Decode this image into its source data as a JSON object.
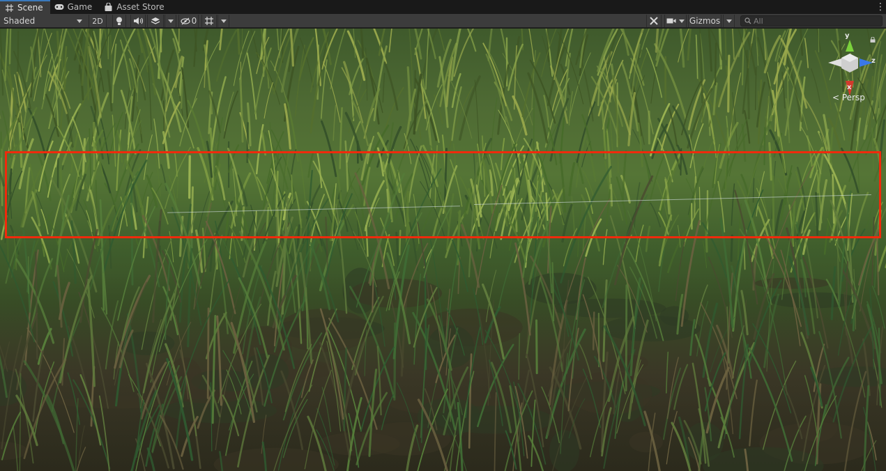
{
  "tabs": [
    {
      "label": "Scene",
      "icon": "grid-icon",
      "active": true
    },
    {
      "label": "Game",
      "icon": "gamepad-icon",
      "active": false
    },
    {
      "label": "Asset Store",
      "icon": "shopping-bag-icon",
      "active": false
    }
  ],
  "toolbar": {
    "draw_mode": "Shaded",
    "toggle_2d": "2D",
    "hidden_count": "0",
    "gizmos_label": "Gizmos",
    "search_placeholder": "All"
  },
  "gizmo": {
    "x_label": "x",
    "y_label": "y",
    "z_label": "z",
    "projection_label": "< Persp"
  },
  "colors": {
    "selection_outline": "#f02a0c",
    "tab_highlight": "#3a79bb",
    "x_axis": "#d23a2c",
    "y_axis": "#7bd23c",
    "z_axis": "#3a78e8"
  }
}
